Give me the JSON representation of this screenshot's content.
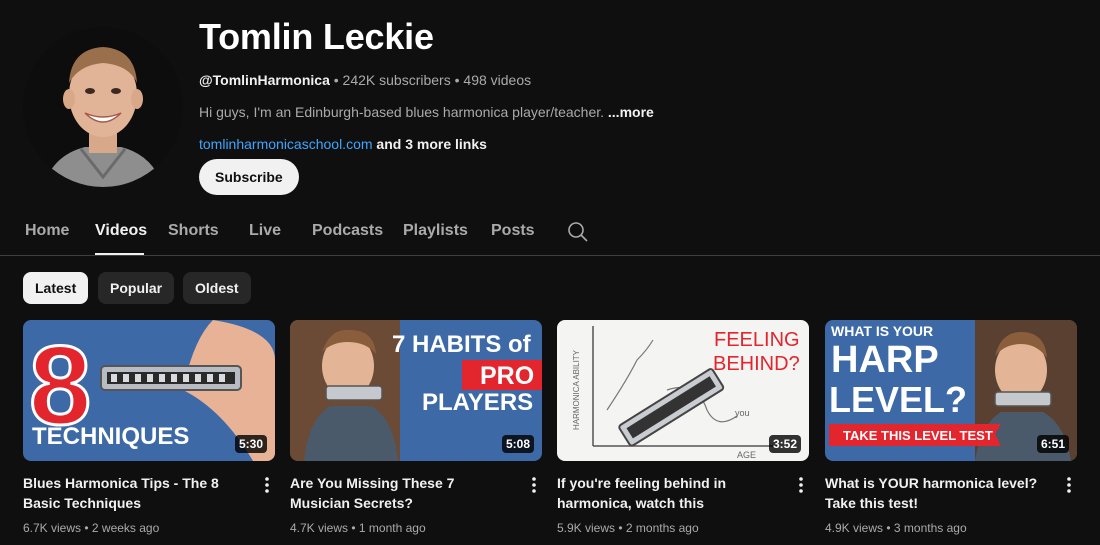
{
  "channel": {
    "name": "Tomlin Leckie",
    "handle": "@TomlinHarmonica",
    "subscribers": "242K subscribers",
    "videos_count": "498 videos",
    "description": "Hi guys, I'm an Edinburgh-based blues harmonica player/teacher.",
    "more_label": "...more",
    "link": "tomlinharmonicaschool.com",
    "more_links": "and 3 more links",
    "subscribe_label": "Subscribe",
    "separator": " • "
  },
  "tabs": [
    "Home",
    "Videos",
    "Shorts",
    "Live",
    "Podcasts",
    "Playlists",
    "Posts"
  ],
  "active_tab": "Videos",
  "chips": [
    "Latest",
    "Popular",
    "Oldest"
  ],
  "active_chip": "Latest",
  "videos": [
    {
      "title": "Blues Harmonica Tips - The 8 Basic Techniques",
      "views": "6.7K views",
      "age": "2 weeks ago",
      "duration": "5:30",
      "thumb_text": [
        "8",
        "TECHNIQUES"
      ]
    },
    {
      "title": "Are You Missing These 7 Musician Secrets?",
      "views": "4.7K views",
      "age": "1 month ago",
      "duration": "5:08",
      "thumb_text": [
        "7 HABITS of",
        "PRO",
        "PLAYERS"
      ]
    },
    {
      "title": "If you're feeling behind in harmonica, watch this",
      "views": "5.9K views",
      "age": "2 months ago",
      "duration": "3:52",
      "thumb_text": [
        "FEELING",
        "BEHIND?",
        "HARMONICA ABILITY",
        "AGE",
        "you"
      ]
    },
    {
      "title": "What is YOUR harmonica level? Take this test!",
      "views": "4.9K views",
      "age": "3 months ago",
      "duration": "6:51",
      "thumb_text": [
        "WHAT IS YOUR",
        "HARP",
        "LEVEL?",
        "TAKE THIS LEVEL TEST"
      ]
    }
  ],
  "colors": {
    "background": "#0f0f0f",
    "link": "#3ea6ff",
    "thumb_blue": "#3d6aa6",
    "thumb_red": "#e3262e"
  },
  "icons": {
    "search": "search-icon",
    "menu": "more-vert-icon"
  }
}
